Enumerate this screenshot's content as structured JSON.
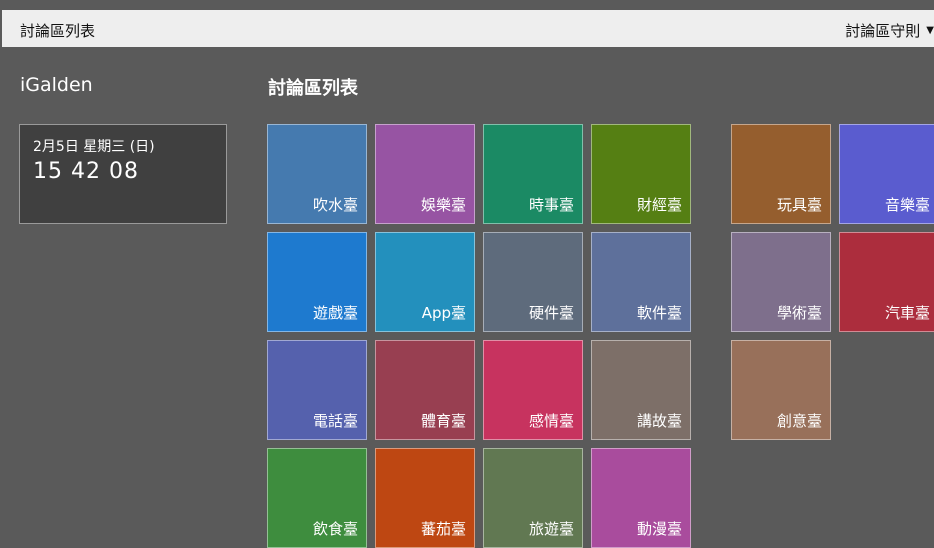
{
  "topbar": {
    "title": "討論區列表",
    "menu_label": "討論區守則",
    "caret": "▼"
  },
  "brand": "iGalden",
  "section_title": "討論區列表",
  "clock": {
    "date": "2月5日 星期三 (日)",
    "time": "15 42 08"
  },
  "tiles": [
    {
      "label": "吹水臺",
      "color": "#457aaf",
      "group": 0,
      "col": 0,
      "row": 0
    },
    {
      "label": "娛樂臺",
      "color": "#9754a3",
      "group": 0,
      "col": 1,
      "row": 0
    },
    {
      "label": "時事臺",
      "color": "#1b8a64",
      "group": 0,
      "col": 2,
      "row": 0
    },
    {
      "label": "財經臺",
      "color": "#557f13",
      "group": 0,
      "col": 3,
      "row": 0
    },
    {
      "label": "遊戲臺",
      "color": "#1e7acf",
      "group": 0,
      "col": 0,
      "row": 1
    },
    {
      "label": "App臺",
      "color": "#2390bd",
      "group": 0,
      "col": 1,
      "row": 1
    },
    {
      "label": "硬件臺",
      "color": "#5e6b7c",
      "group": 0,
      "col": 2,
      "row": 1
    },
    {
      "label": "軟件臺",
      "color": "#5e709b",
      "group": 0,
      "col": 3,
      "row": 1
    },
    {
      "label": "電話臺",
      "color": "#5561ad",
      "group": 0,
      "col": 0,
      "row": 2
    },
    {
      "label": "體育臺",
      "color": "#983f51",
      "group": 0,
      "col": 1,
      "row": 2
    },
    {
      "label": "感情臺",
      "color": "#c7335f",
      "group": 0,
      "col": 2,
      "row": 2
    },
    {
      "label": "講故臺",
      "color": "#7d6f68",
      "group": 0,
      "col": 3,
      "row": 2
    },
    {
      "label": "飲食臺",
      "color": "#3e8d3e",
      "group": 0,
      "col": 0,
      "row": 3
    },
    {
      "label": "蕃茄臺",
      "color": "#be4712",
      "group": 0,
      "col": 1,
      "row": 3
    },
    {
      "label": "旅遊臺",
      "color": "#617852",
      "group": 0,
      "col": 2,
      "row": 3
    },
    {
      "label": "動漫臺",
      "color": "#a94c9d",
      "group": 0,
      "col": 3,
      "row": 3
    },
    {
      "label": "玩具臺",
      "color": "#955e2e",
      "group": 1,
      "col": 0,
      "row": 0
    },
    {
      "label": "音樂臺",
      "color": "#5a5ccf",
      "group": 1,
      "col": 1,
      "row": 0
    },
    {
      "label": "學術臺",
      "color": "#7e6f8c",
      "group": 1,
      "col": 0,
      "row": 1
    },
    {
      "label": "汽車臺",
      "color": "#ac2d3d",
      "group": 1,
      "col": 1,
      "row": 1
    },
    {
      "label": "創意臺",
      "color": "#98705a",
      "group": 1,
      "col": 0,
      "row": 2
    }
  ]
}
